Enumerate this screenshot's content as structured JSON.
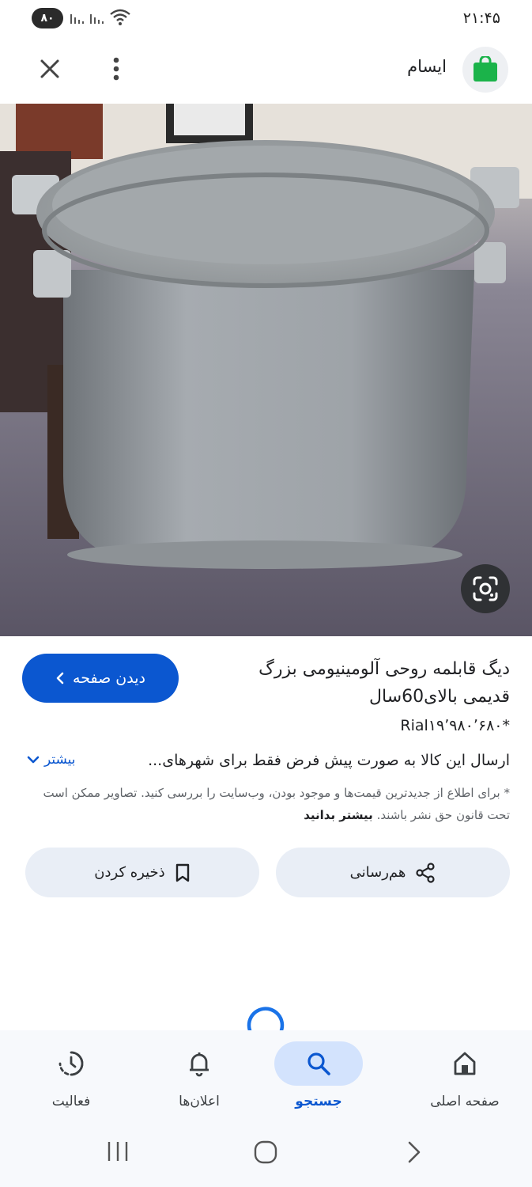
{
  "status_bar": {
    "time": "۲۱:۴۵",
    "battery": "۸۰"
  },
  "header": {
    "site_name": "ایسام"
  },
  "item": {
    "title": "دیگ قابلمه روحی آلومینیومی بزرگ قدیمی بالای60سال",
    "price": "*Rial۱۹٬۹۸۰٬۶۸۰",
    "visit_label": "دیدن صفحه",
    "description": "ارسال این کالا به صورت پیش فرض فقط برای شهرهای...",
    "more_label": "بیشتر",
    "disclaimer": "* برای اطلاع از جدیدترین قیمت‌ها و موجود بودن، وب‌سایت را بررسی کنید. تصاویر ممکن است تحت قانون حق نشر باشند.",
    "disclaimer_link": "بیشتر بدانید"
  },
  "actions": {
    "share_label": "هم‌رسانی",
    "save_label": "ذخیره کردن"
  },
  "nav": [
    {
      "label": "صفحه اصلی",
      "icon": "home-icon"
    },
    {
      "label": "جستجو",
      "icon": "search-icon",
      "active": true
    },
    {
      "label": "اعلان‌ها",
      "icon": "bell-icon"
    },
    {
      "label": "فعالیت",
      "icon": "activity-icon"
    }
  ],
  "colors": {
    "accent": "#0b57d0",
    "pill": "#d3e3fd",
    "button_bg": "#e9eef6"
  }
}
